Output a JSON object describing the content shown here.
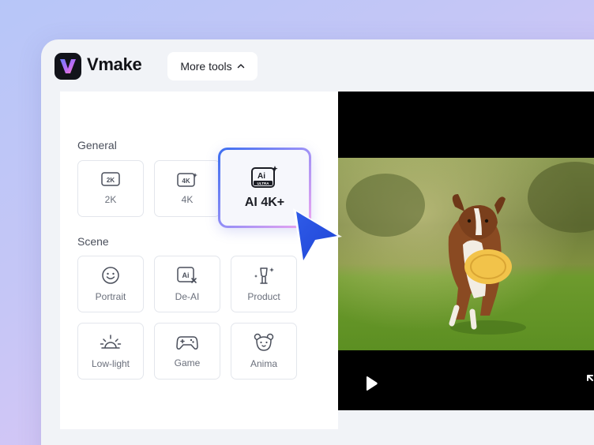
{
  "app": {
    "brand": "Vmake",
    "logo_icon": "vmake-logo-icon",
    "more_tools_label": "More tools",
    "more_tools_icon": "chevron-up-icon"
  },
  "sections": {
    "general": "General",
    "scene": "Scene"
  },
  "general_tools": [
    {
      "label": "2K",
      "icon": "2k-icon"
    },
    {
      "label": "4K",
      "icon": "4k-icon"
    },
    {
      "label": "AI 4K+",
      "icon": "ai-ultra-icon",
      "highlighted": true
    }
  ],
  "scene_tools": [
    {
      "label": "Portrait",
      "icon": "smiley-face-icon"
    },
    {
      "label": "De-AI",
      "icon": "de-ai-icon"
    },
    {
      "label": "Product",
      "icon": "product-icon"
    },
    {
      "label": "Low-light",
      "icon": "sunrise-icon"
    },
    {
      "label": "Game",
      "icon": "gamepad-icon"
    },
    {
      "label": "Anima",
      "icon": "bear-face-icon"
    }
  ],
  "icon_text": {
    "k2": "2K",
    "k4": "4K",
    "ai": "Ai",
    "ultra": "ULTRA",
    "deai": "Ai"
  },
  "video": {
    "subject": "dog-with-frisbee-image",
    "play_icon": "play-icon",
    "expand_icon": "expand-icon"
  },
  "colors": {
    "accent_blue": "#2f5be8",
    "gradient_pink": "#f2a6f0",
    "background_lavender": "#c9c6f6"
  }
}
